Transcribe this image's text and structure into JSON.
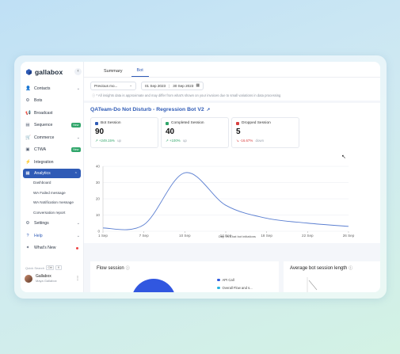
{
  "brand": {
    "name": "gallabox"
  },
  "sidebar": {
    "items": [
      {
        "label": "Contacts",
        "icon": "contacts-icon",
        "chevron": true
      },
      {
        "label": "Bots",
        "icon": "bot-icon"
      },
      {
        "label": "Broadcast",
        "icon": "broadcast-icon"
      },
      {
        "label": "Sequence",
        "icon": "sequence-icon",
        "badge": "New"
      },
      {
        "label": "Commerce",
        "icon": "cart-icon",
        "chevron": true
      },
      {
        "label": "CTWA",
        "icon": "ctwa-icon",
        "badge": "New"
      },
      {
        "label": "Integration",
        "icon": "plug-icon"
      }
    ],
    "analytics": {
      "label": "Analytics",
      "subitems": [
        "Dashboard",
        "WA Failed message",
        "WA Notification message",
        "Conversation report"
      ]
    },
    "settings": "Settings",
    "help": "Help",
    "whats_new": "What's New",
    "quick_search": "Quick Search",
    "quick_search_keys": [
      "Ctrl",
      "K"
    ],
    "user": {
      "name": "Gallabox",
      "subtitle": "Maya Gallabox"
    }
  },
  "tabs": [
    {
      "label": "Summary",
      "active": false
    },
    {
      "label": "Bot",
      "active": true
    }
  ],
  "filters": {
    "period": "Previous mo...",
    "date_from": "01 Sep 2023",
    "date_to": "30 Sep 2023"
  },
  "note": "* All insights data is approximate and may differ from what's shown on your invoices due to small variations in data processing",
  "bot_title": "QATeam-Do Not Disturb - Regression Bot V2",
  "stats": [
    {
      "label": "Bot Session",
      "value": "90",
      "delta": "+249.15%",
      "direction": "up",
      "color": "#2f5bb6",
      "delta_color": "#31a66b",
      "arrow": "↗"
    },
    {
      "label": "Completed Session",
      "value": "40",
      "delta": "+100%",
      "direction": "up",
      "color": "#31a66b",
      "delta_color": "#31a66b",
      "arrow": "↗"
    },
    {
      "label": "Dropped Session",
      "value": "5",
      "delta": "-16.67%",
      "direction": "down",
      "color": "#d94040",
      "delta_color": "#d94040",
      "arrow": "↘"
    }
  ],
  "chart_data": {
    "type": "line",
    "x": [
      "1 Sep",
      "7 Sep",
      "10 Sep",
      "14 Sep",
      "18 Sep",
      "22 Sep",
      "26 Sep"
    ],
    "series": [
      {
        "values": [
          2,
          4,
          36,
          16,
          8,
          5,
          3
        ]
      }
    ],
    "ylim": [
      0,
      40
    ],
    "yticks": [
      0,
      10,
      20,
      30,
      40
    ],
    "xlabel": "Day Vs Chat bot initiations",
    "ylabel": ""
  },
  "panels": {
    "flow_session": "Flow session",
    "avg_length": "Average bot session length",
    "legend": [
      "API Call",
      "Overall Flow and s..."
    ],
    "legend_colors": [
      "#2f5bdf",
      "#26b3e0"
    ]
  }
}
